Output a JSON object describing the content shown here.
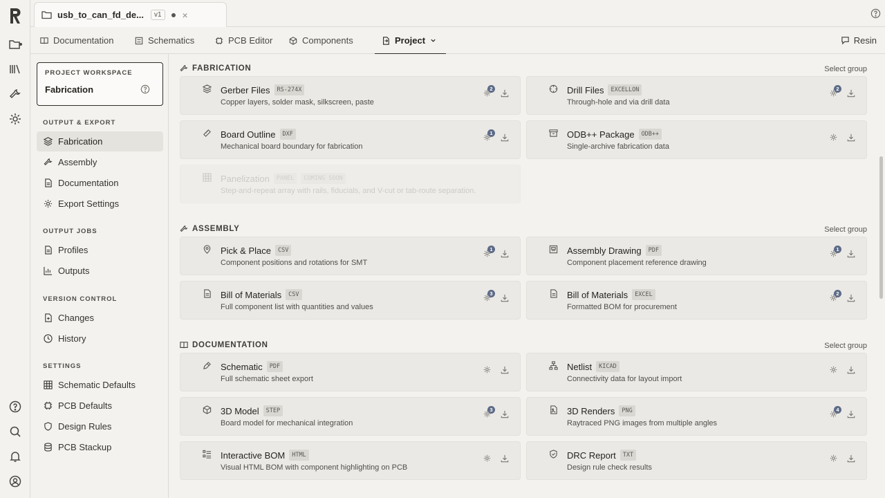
{
  "file_tab": {
    "name": "usb_to_can_fd_de...",
    "version": "v1",
    "close": "×"
  },
  "nav_tabs": [
    {
      "label": "Documentation",
      "icon": "book-icon"
    },
    {
      "label": "Schematics",
      "icon": "schematic-icon"
    },
    {
      "label": "PCB Editor",
      "icon": "chip-icon"
    },
    {
      "label": "Components",
      "icon": "cube-icon"
    },
    {
      "label": "Project",
      "icon": "project-icon",
      "active": true
    }
  ],
  "resin_label": "Resin",
  "workspace": {
    "label": "PROJECT WORKSPACE",
    "value": "Fabrication"
  },
  "sidebar": [
    {
      "heading": "OUTPUT & EXPORT",
      "items": [
        {
          "label": "Fabrication",
          "icon": "layers-icon",
          "active": true
        },
        {
          "label": "Assembly",
          "icon": "wrench-icon"
        },
        {
          "label": "Documentation",
          "icon": "document-icon"
        },
        {
          "label": "Export Settings",
          "icon": "gear-icon"
        }
      ]
    },
    {
      "heading": "OUTPUT JOBS",
      "items": [
        {
          "label": "Profiles",
          "icon": "document-icon"
        },
        {
          "label": "Outputs",
          "icon": "chart-icon"
        }
      ]
    },
    {
      "heading": "VERSION CONTROL",
      "items": [
        {
          "label": "Changes",
          "icon": "document-plus-icon"
        },
        {
          "label": "History",
          "icon": "clock-icon"
        }
      ]
    },
    {
      "heading": "SETTINGS",
      "items": [
        {
          "label": "Schematic Defaults",
          "icon": "grid-icon"
        },
        {
          "label": "PCB Defaults",
          "icon": "chip-icon"
        },
        {
          "label": "Design Rules",
          "icon": "shield-icon"
        },
        {
          "label": "PCB Stackup",
          "icon": "database-icon"
        }
      ]
    }
  ],
  "select_group": "Select group",
  "groups": [
    {
      "title": "FABRICATION",
      "icon": "wrench-icon",
      "cards": [
        {
          "title": "Gerber Files",
          "badge": "RS-274X",
          "desc": "Copper layers, solder mask, silkscreen, paste",
          "icon": "layers-icon",
          "count": "2"
        },
        {
          "title": "Drill Files",
          "badge": "EXCELLON",
          "desc": "Through-hole and via drill data",
          "icon": "crosshair-icon",
          "count": "2"
        },
        {
          "title": "Board Outline",
          "badge": "DXF",
          "desc": "Mechanical board boundary for fabrication",
          "icon": "ruler-icon",
          "count": "1"
        },
        {
          "title": "ODB++ Package",
          "badge": "ODB++",
          "desc": "Single-archive fabrication data",
          "icon": "archive-icon",
          "count": ""
        },
        {
          "title": "Panelization",
          "badge": "PANEL",
          "badge2": "COMING SOON",
          "desc": "Step-and-repeat array with rails, fiducials, and V-cut or tab-route separation.",
          "icon": "grid-icon",
          "count": "",
          "disabled": true
        }
      ]
    },
    {
      "title": "ASSEMBLY",
      "icon": "wrench-icon",
      "cards": [
        {
          "title": "Pick & Place",
          "badge": "CSV",
          "desc": "Component positions and rotations for SMT",
          "icon": "pin-icon",
          "count": "1"
        },
        {
          "title": "Assembly Drawing",
          "badge": "PDF",
          "desc": "Component placement reference drawing",
          "icon": "drawing-icon",
          "count": "1"
        },
        {
          "title": "Bill of Materials",
          "badge": "CSV",
          "desc": "Full component list with quantities and values",
          "icon": "document-icon",
          "count": "3"
        },
        {
          "title": "Bill of Materials",
          "badge": "EXCEL",
          "desc": "Formatted BOM for procurement",
          "icon": "document-icon",
          "count": "2"
        }
      ]
    },
    {
      "title": "DOCUMENTATION",
      "icon": "book-icon",
      "cards": [
        {
          "title": "Schematic",
          "badge": "PDF",
          "desc": "Full schematic sheet export",
          "icon": "pen-icon",
          "count": ""
        },
        {
          "title": "Netlist",
          "badge": "KICAD",
          "desc": "Connectivity data for layout import",
          "icon": "network-icon",
          "count": ""
        },
        {
          "title": "3D Model",
          "badge": "STEP",
          "desc": "Board model for mechanical integration",
          "icon": "cube-icon",
          "count": "3"
        },
        {
          "title": "3D Renders",
          "badge": "PNG",
          "desc": "Raytraced PNG images from multiple angles",
          "icon": "image-icon",
          "count": "4"
        },
        {
          "title": "Interactive BOM",
          "badge": "HTML",
          "desc": "Visual HTML BOM with component highlighting on PCB",
          "icon": "list-icon",
          "count": ""
        },
        {
          "title": "DRC Report",
          "badge": "TXT",
          "desc": "Design rule check results",
          "icon": "shield-check-icon",
          "count": ""
        }
      ]
    }
  ]
}
